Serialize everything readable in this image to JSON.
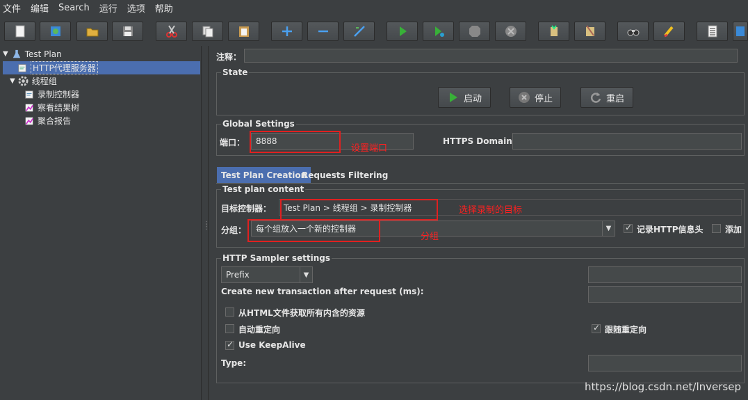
{
  "menu": [
    "文件",
    "编辑",
    "Search",
    "运行",
    "选项",
    "帮助"
  ],
  "toolbar": {
    "icons": [
      "new-icon",
      "templates-icon",
      "open-icon",
      "save-icon",
      "cut-icon",
      "copy-icon",
      "paste-icon",
      "expand-icon",
      "collapse-icon",
      "toggle-icon",
      "start-icon",
      "start-no-pause-icon",
      "stop-icon",
      "shutdown-icon",
      "clear-icon",
      "clear-all-icon",
      "search-icon",
      "reset-search-icon",
      "function-helper-icon",
      "help-icon"
    ]
  },
  "tree": {
    "items": [
      {
        "label": "Test Plan",
        "icon": "test-plan-icon"
      },
      {
        "label": "HTTP代理服务器",
        "icon": "proxy-server-icon"
      },
      {
        "label": "线程组",
        "icon": "thread-group-icon"
      },
      {
        "label": "录制控制器",
        "icon": "recording-controller-icon"
      },
      {
        "label": "察看结果树",
        "icon": "view-results-tree-icon"
      },
      {
        "label": "聚合报告",
        "icon": "aggregate-report-icon"
      }
    ]
  },
  "main": {
    "comment_label": "注释：",
    "state": {
      "title": "State",
      "start_label": "启动",
      "stop_label": "停止",
      "restart_label": "重启"
    },
    "global": {
      "title": "Global Settings",
      "port_label": "端口：",
      "port_value": "8888",
      "https_label": "HTTPS Domains:"
    },
    "tabs": [
      "Test Plan Creation",
      "Requests Filtering"
    ],
    "content": {
      "title": "Test plan content",
      "target_label": "目标控制器：",
      "target_value": "Test Plan > 线程组 > 录制控制器",
      "group_label": "分组：",
      "group_value": "每个组放入一个新的控制器",
      "record_headers_label": "记录HTTP信息头",
      "add_label": "添加"
    },
    "sampler": {
      "title": "HTTP Sampler settings",
      "prefix_value": "Prefix",
      "transaction_label": "Create new transaction after request (ms):",
      "retrieve_label": "从HTML文件获取所有内含的资源",
      "redirect_label": "自动重定向",
      "follow_label": "跟随重定向",
      "keepalive_label": "Use KeepAlive",
      "type_label": "Type:"
    }
  },
  "annotations": {
    "port": "设置端口",
    "target": "选择录制的目标",
    "group": "分组"
  },
  "watermark": "https://blog.csdn.net/lnversep"
}
